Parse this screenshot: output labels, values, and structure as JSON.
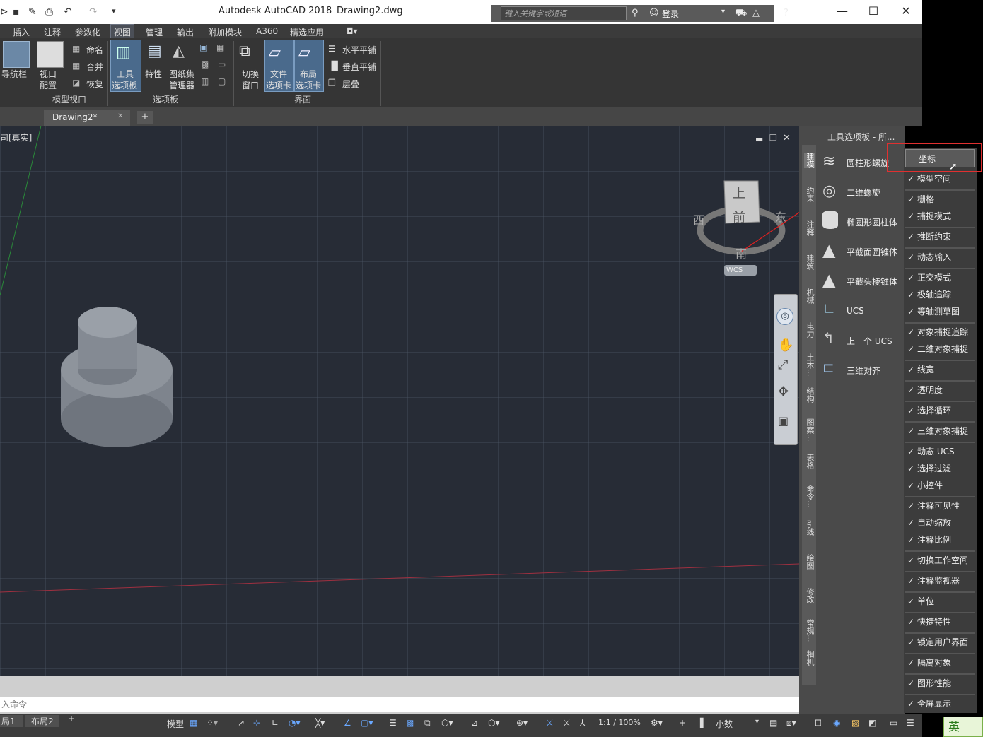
{
  "title_bar": {
    "app_title": "Autodesk AutoCAD 2018",
    "doc_title": "Drawing2.dwg",
    "search_placeholder": "键入关键字或短语",
    "login_label": "登录",
    "minimize": "—",
    "maximize": "☐",
    "close": "✕"
  },
  "ribbon_tabs": [
    "插入",
    "注释",
    "参数化",
    "视图",
    "管理",
    "输出",
    "附加模块",
    "A360",
    "精选应用"
  ],
  "ribbon": {
    "nav_label": "导航栏",
    "viewport_config_1": "视口",
    "viewport_config_2": "配置",
    "named": "命名",
    "join": "合并",
    "restore": "恢复",
    "tool_palette_1": "工具",
    "tool_palette_2": "选项板",
    "properties": "特性",
    "sheetset_1": "图纸集",
    "sheetset_2": "管理器",
    "switch_window_1": "切换",
    "switch_window_2": "窗口",
    "file_tabs_1": "文件",
    "file_tabs_2": "选项卡",
    "layout_tabs_1": "布局",
    "layout_tabs_2": "选项卡",
    "tile_h": "水平平铺",
    "tile_v": "垂直平铺",
    "cascade": "层叠",
    "group_model_viewport": "模型视口",
    "group_palettes": "选项板",
    "group_interface": "界面"
  },
  "doc_tab": {
    "label": "Drawing2*",
    "close": "✕",
    "add": "+"
  },
  "viewport": {
    "label": "司[真实]",
    "compass": {
      "top": "上",
      "front": "前",
      "west": "西",
      "east": "东",
      "south": "南",
      "wcs": "WCS"
    }
  },
  "palette": {
    "title": "工具选项板 - 所...",
    "tabs": [
      "建模",
      "约束",
      "注释",
      "建筑",
      "机械",
      "电力",
      "土木...",
      "结构",
      "图案...",
      "表格",
      "命令...",
      "引线",
      "绘图",
      "修改",
      "常规...",
      "相机"
    ],
    "items": [
      "圆柱形螺旋",
      "二维螺旋",
      "椭圆形圆柱体",
      "平截面圆锥体",
      "平截头棱锥体",
      "UCS",
      "上一个 UCS",
      "三维对齐"
    ]
  },
  "status_menu": {
    "top": "坐标",
    "items": [
      [
        "模型空间"
      ],
      [
        "栅格",
        "捕捉模式"
      ],
      [
        "推断约束"
      ],
      [
        "动态输入"
      ],
      [
        "正交模式",
        "极轴追踪",
        "等轴测草图"
      ],
      [
        "对象捕捉追踪",
        "二维对象捕捉"
      ],
      [
        "线宽"
      ],
      [
        "透明度"
      ],
      [
        "选择循环"
      ],
      [
        "三维对象捕捉"
      ],
      [
        "动态 UCS",
        "选择过滤",
        "小控件"
      ],
      [
        "注释可见性",
        "自动缩放",
        "注释比例"
      ],
      [
        "切换工作空间"
      ],
      [
        "注释监视器"
      ],
      [
        "单位"
      ],
      [
        "快捷特性"
      ],
      [
        "锁定用户界面"
      ],
      [
        "隔离对象"
      ],
      [
        "图形性能"
      ],
      [
        "全屏显示"
      ]
    ],
    "check": "✓"
  },
  "command": {
    "placeholder": "入命令"
  },
  "status_bar": {
    "layout1": "局1",
    "layout2": "布局2",
    "add": "+",
    "model": "模型",
    "scale": "1:1 / 100%",
    "units": "小数"
  },
  "ime": "英"
}
